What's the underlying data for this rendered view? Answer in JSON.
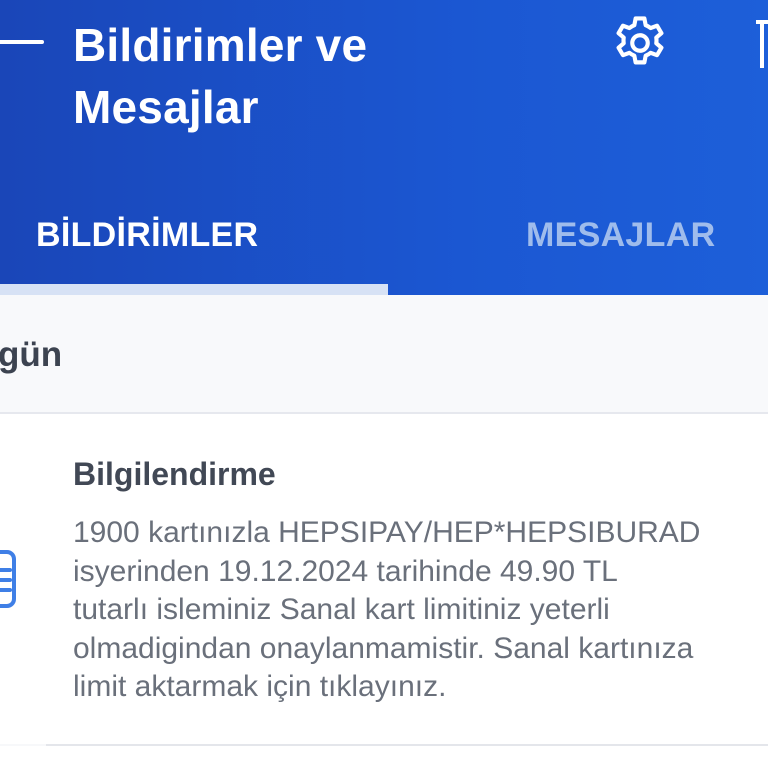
{
  "header": {
    "title": "Bildirimler ve Mesajlar",
    "back_icon": "arrow-left-icon",
    "settings_icon": "gear-icon",
    "delete_icon": "trash-icon",
    "background_color": "#1b57d2"
  },
  "tabs": [
    {
      "label": "BİLDİRİMLER",
      "selected": true
    },
    {
      "label": "MESAJLAR",
      "selected": false
    }
  ],
  "section": {
    "label": "gün"
  },
  "notification": {
    "icon": "receipt-icon",
    "title": "Bilgilendirme",
    "body": "1900 kartınızla HEPSIPAY/HEP*HEPSIBURAD\nisyerinden 19.12.2024 tarihinde 49.90 TL\ntutarlı isleminiz Sanal kart limitiniz yeterli\nolmadigindan onaylanmamistir. Sanal kartınıza\nlimit aktarmak için tıklayınız."
  }
}
